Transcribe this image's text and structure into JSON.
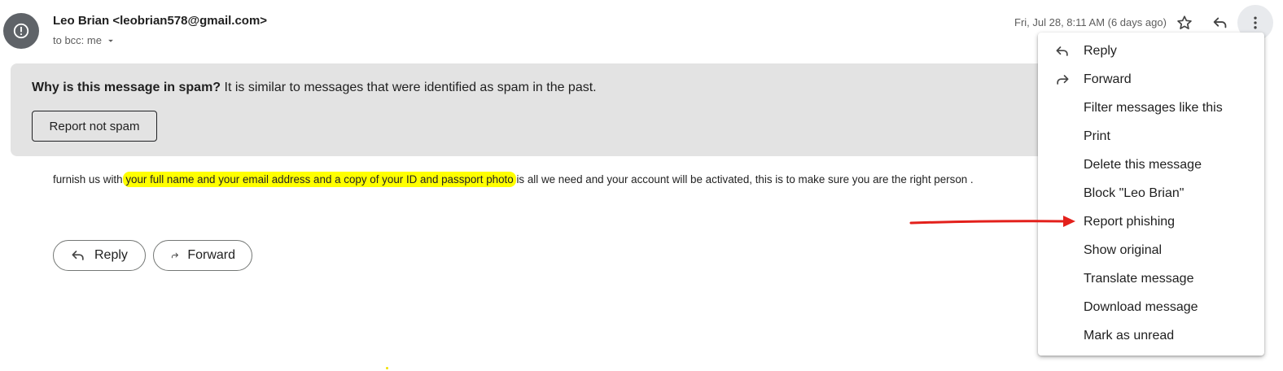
{
  "header": {
    "sender": "Leo Brian <leobrian578@gmail.com>",
    "recipients": "to bcc: me",
    "date": "Fri, Jul 28, 8:11 AM (6 days ago)",
    "icons": [
      "alert-icon",
      "chevron-down-icon",
      "star-icon",
      "reply-icon",
      "more-vert-icon"
    ]
  },
  "banner": {
    "question": "Why is this message in spam?",
    "explanation": " It is similar to messages that were identified as spam in the past.",
    "button": "Report not spam"
  },
  "body": {
    "before": "furnish us with",
    "highlighted": " your full name and your email address and a copy of your ID and passport photo ",
    "after": "is all we need and your account will be activated, this is to make sure you are the right person ."
  },
  "actions": {
    "reply": "Reply",
    "forward": "Forward"
  },
  "menu": {
    "items": [
      {
        "label": "Reply",
        "icon": "reply-icon"
      },
      {
        "label": "Forward",
        "icon": "forward-icon"
      },
      {
        "label": "Filter messages like this"
      },
      {
        "label": "Print"
      },
      {
        "label": "Delete this message"
      },
      {
        "label": "Block \"Leo Brian\""
      },
      {
        "label": "Report phishing"
      },
      {
        "label": "Show original"
      },
      {
        "label": "Translate message"
      },
      {
        "label": "Download message"
      },
      {
        "label": "Mark as unread"
      }
    ]
  },
  "colors": {
    "highlight": "#ffff00",
    "banner": "#e3e3e3",
    "annotation_arrow": "#e3201b"
  }
}
